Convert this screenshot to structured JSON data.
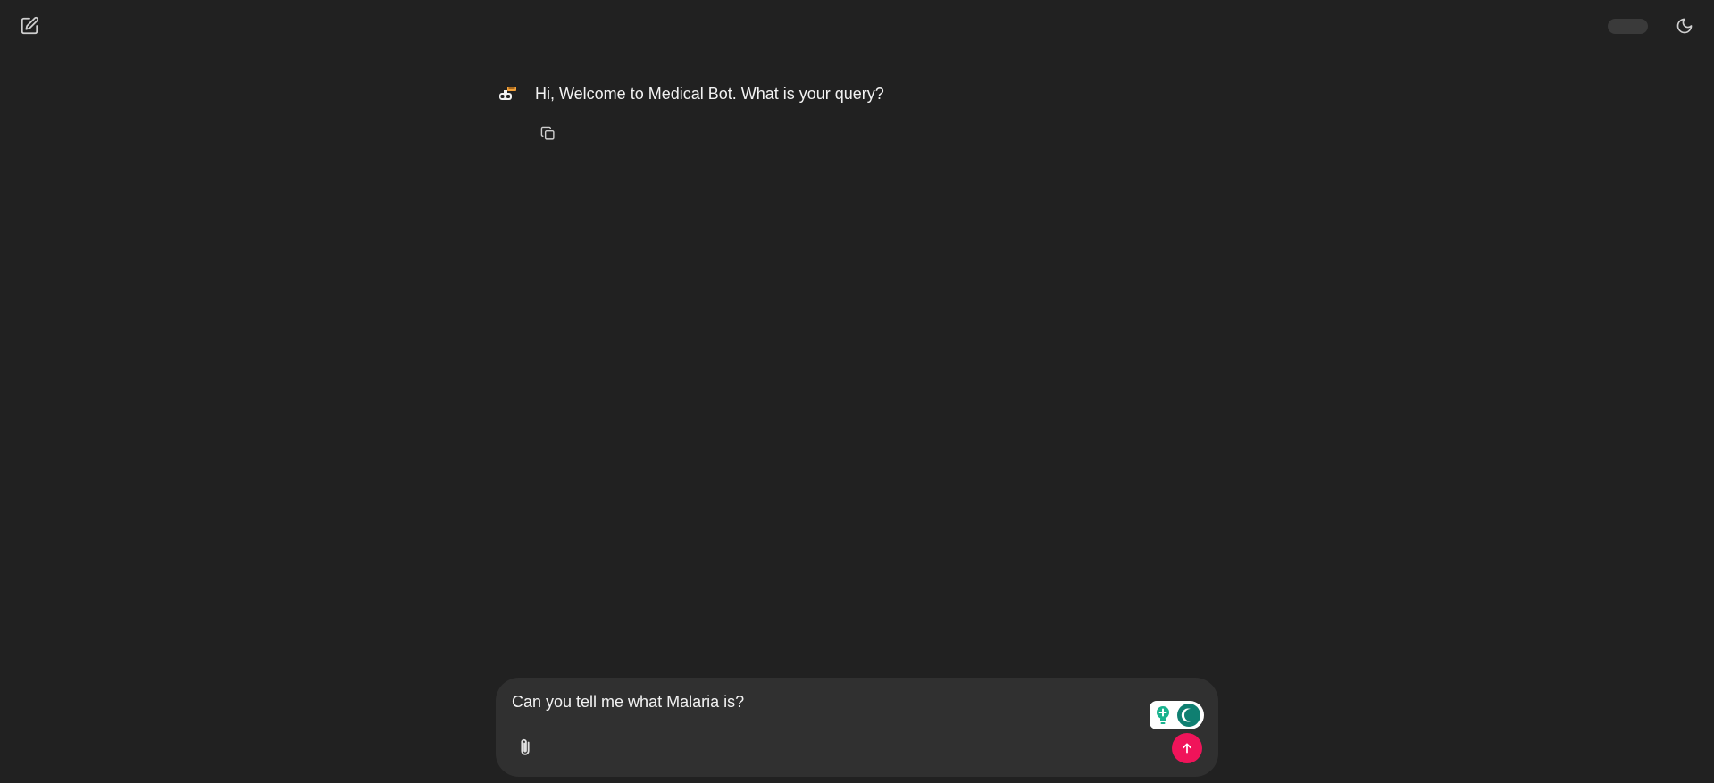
{
  "header": {
    "new_chat_icon": "edit-square-icon",
    "pill_label": "",
    "theme_icon": "moon-icon"
  },
  "chat": {
    "messages": [
      {
        "sender": "bot",
        "avatar_icon": "robot-icon",
        "text": "Hi, Welcome to Medical Bot. What is your query?",
        "action_icon": "copy-icon"
      }
    ]
  },
  "composer": {
    "input_value": "Can you tell me what Malaria is?",
    "attach_icon": "paperclip-icon",
    "toggle_icon": "lightbulb-icon",
    "send_icon": "arrow-up-icon"
  },
  "colors": {
    "background": "#212121",
    "composer_bg": "#303030",
    "send_button": "#f0145a",
    "toggle_accent": "#0f7f71",
    "bulb_green": "#19b28e"
  }
}
